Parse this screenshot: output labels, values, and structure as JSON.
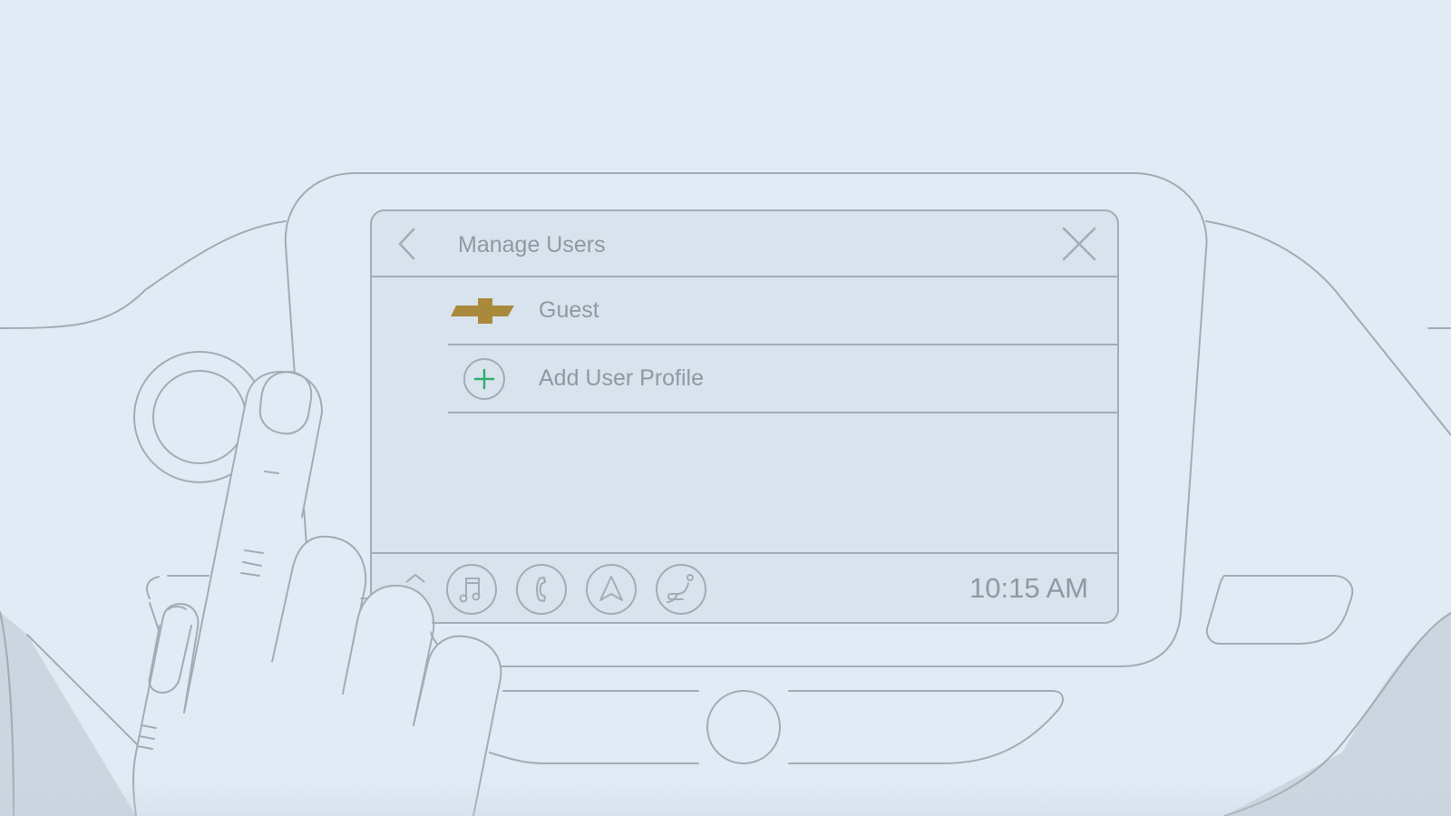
{
  "screen": {
    "title": "Manage Users",
    "users": [
      {
        "label": "Guest",
        "icon": "bowtie-logo-icon"
      },
      {
        "label": "Add User Profile",
        "icon": "plus-circle-icon"
      }
    ],
    "clock": "10:15 AM",
    "dock": [
      "home-icon",
      "music-icon",
      "phone-icon",
      "navigation-icon",
      "seat-icon"
    ]
  },
  "colors": {
    "background": "#e1ebf5",
    "screen": "#d9e3ed",
    "outline": "#a3acb6",
    "text": "#8f99a3",
    "logo_gold": "#a98a3c",
    "plus_green": "#2fae6e"
  }
}
